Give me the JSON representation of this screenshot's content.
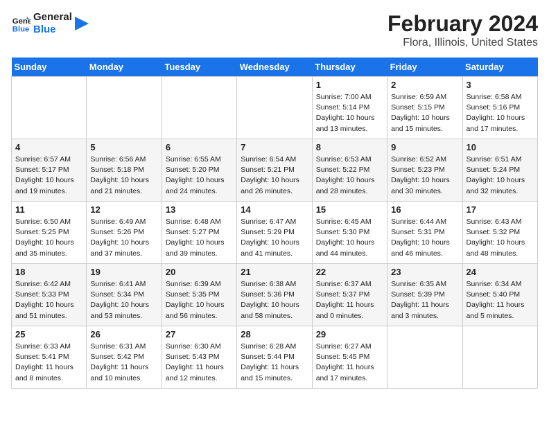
{
  "header": {
    "logo_line1": "General",
    "logo_line2": "Blue",
    "title": "February 2024",
    "subtitle": "Flora, Illinois, United States"
  },
  "days_of_week": [
    "Sunday",
    "Monday",
    "Tuesday",
    "Wednesday",
    "Thursday",
    "Friday",
    "Saturday"
  ],
  "weeks": [
    [
      {
        "day": "",
        "info": ""
      },
      {
        "day": "",
        "info": ""
      },
      {
        "day": "",
        "info": ""
      },
      {
        "day": "",
        "info": ""
      },
      {
        "day": "1",
        "info": "Sunrise: 7:00 AM\nSunset: 5:14 PM\nDaylight: 10 hours\nand 13 minutes."
      },
      {
        "day": "2",
        "info": "Sunrise: 6:59 AM\nSunset: 5:15 PM\nDaylight: 10 hours\nand 15 minutes."
      },
      {
        "day": "3",
        "info": "Sunrise: 6:58 AM\nSunset: 5:16 PM\nDaylight: 10 hours\nand 17 minutes."
      }
    ],
    [
      {
        "day": "4",
        "info": "Sunrise: 6:57 AM\nSunset: 5:17 PM\nDaylight: 10 hours\nand 19 minutes."
      },
      {
        "day": "5",
        "info": "Sunrise: 6:56 AM\nSunset: 5:18 PM\nDaylight: 10 hours\nand 21 minutes."
      },
      {
        "day": "6",
        "info": "Sunrise: 6:55 AM\nSunset: 5:20 PM\nDaylight: 10 hours\nand 24 minutes."
      },
      {
        "day": "7",
        "info": "Sunrise: 6:54 AM\nSunset: 5:21 PM\nDaylight: 10 hours\nand 26 minutes."
      },
      {
        "day": "8",
        "info": "Sunrise: 6:53 AM\nSunset: 5:22 PM\nDaylight: 10 hours\nand 28 minutes."
      },
      {
        "day": "9",
        "info": "Sunrise: 6:52 AM\nSunset: 5:23 PM\nDaylight: 10 hours\nand 30 minutes."
      },
      {
        "day": "10",
        "info": "Sunrise: 6:51 AM\nSunset: 5:24 PM\nDaylight: 10 hours\nand 32 minutes."
      }
    ],
    [
      {
        "day": "11",
        "info": "Sunrise: 6:50 AM\nSunset: 5:25 PM\nDaylight: 10 hours\nand 35 minutes."
      },
      {
        "day": "12",
        "info": "Sunrise: 6:49 AM\nSunset: 5:26 PM\nDaylight: 10 hours\nand 37 minutes."
      },
      {
        "day": "13",
        "info": "Sunrise: 6:48 AM\nSunset: 5:27 PM\nDaylight: 10 hours\nand 39 minutes."
      },
      {
        "day": "14",
        "info": "Sunrise: 6:47 AM\nSunset: 5:29 PM\nDaylight: 10 hours\nand 41 minutes."
      },
      {
        "day": "15",
        "info": "Sunrise: 6:45 AM\nSunset: 5:30 PM\nDaylight: 10 hours\nand 44 minutes."
      },
      {
        "day": "16",
        "info": "Sunrise: 6:44 AM\nSunset: 5:31 PM\nDaylight: 10 hours\nand 46 minutes."
      },
      {
        "day": "17",
        "info": "Sunrise: 6:43 AM\nSunset: 5:32 PM\nDaylight: 10 hours\nand 48 minutes."
      }
    ],
    [
      {
        "day": "18",
        "info": "Sunrise: 6:42 AM\nSunset: 5:33 PM\nDaylight: 10 hours\nand 51 minutes."
      },
      {
        "day": "19",
        "info": "Sunrise: 6:41 AM\nSunset: 5:34 PM\nDaylight: 10 hours\nand 53 minutes."
      },
      {
        "day": "20",
        "info": "Sunrise: 6:39 AM\nSunset: 5:35 PM\nDaylight: 10 hours\nand 56 minutes."
      },
      {
        "day": "21",
        "info": "Sunrise: 6:38 AM\nSunset: 5:36 PM\nDaylight: 10 hours\nand 58 minutes."
      },
      {
        "day": "22",
        "info": "Sunrise: 6:37 AM\nSunset: 5:37 PM\nDaylight: 11 hours\nand 0 minutes."
      },
      {
        "day": "23",
        "info": "Sunrise: 6:35 AM\nSunset: 5:39 PM\nDaylight: 11 hours\nand 3 minutes."
      },
      {
        "day": "24",
        "info": "Sunrise: 6:34 AM\nSunset: 5:40 PM\nDaylight: 11 hours\nand 5 minutes."
      }
    ],
    [
      {
        "day": "25",
        "info": "Sunrise: 6:33 AM\nSunset: 5:41 PM\nDaylight: 11 hours\nand 8 minutes."
      },
      {
        "day": "26",
        "info": "Sunrise: 6:31 AM\nSunset: 5:42 PM\nDaylight: 11 hours\nand 10 minutes."
      },
      {
        "day": "27",
        "info": "Sunrise: 6:30 AM\nSunset: 5:43 PM\nDaylight: 11 hours\nand 12 minutes."
      },
      {
        "day": "28",
        "info": "Sunrise: 6:28 AM\nSunset: 5:44 PM\nDaylight: 11 hours\nand 15 minutes."
      },
      {
        "day": "29",
        "info": "Sunrise: 6:27 AM\nSunset: 5:45 PM\nDaylight: 11 hours\nand 17 minutes."
      },
      {
        "day": "",
        "info": ""
      },
      {
        "day": "",
        "info": ""
      }
    ]
  ]
}
